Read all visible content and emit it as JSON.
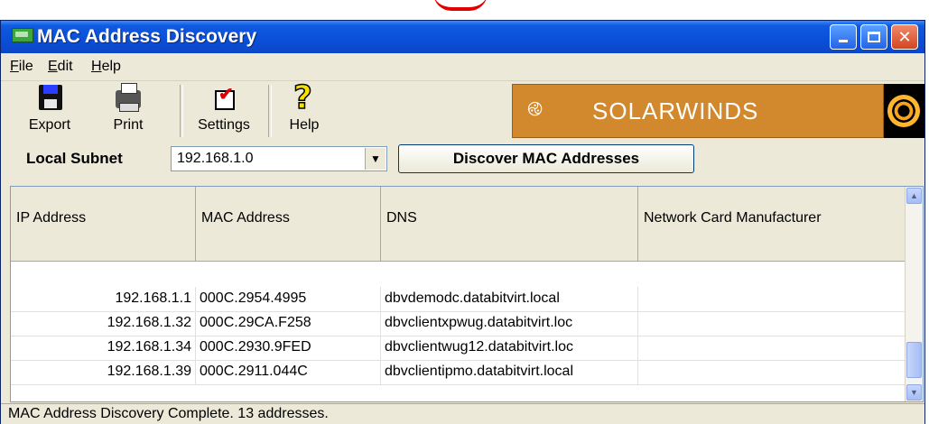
{
  "window": {
    "title": "MAC Address Discovery"
  },
  "menu": [
    {
      "label": "File",
      "underline": "F",
      "rest": "ile"
    },
    {
      "label": "Edit",
      "underline": "E",
      "rest": "dit"
    },
    {
      "label": "Help",
      "underline": "H",
      "rest": "elp"
    }
  ],
  "toolbar": {
    "export_label": "Export",
    "print_label": "Print",
    "settings_label": "Settings",
    "help_label": "Help"
  },
  "brand": {
    "name": "SOLARWINDS",
    "color": "#d2882c"
  },
  "subnet": {
    "label": "Local Subnet",
    "value": "192.168.1.0"
  },
  "discover_button": "Discover MAC Addresses",
  "table": {
    "columns": [
      "IP Address",
      "MAC Address",
      "DNS",
      "Network Card Manufacturer"
    ],
    "rows": [
      [
        "192.168.1.1",
        "000C.2954.4995",
        "dbvdemodc.databitvirt.local",
        ""
      ],
      [
        "192.168.1.32",
        "000C.29CA.F258",
        "dbvclientxpwug.databitvirt.loc",
        ""
      ],
      [
        "192.168.1.34",
        "000C.2930.9FED",
        "dbvclientwug12.databitvirt.loc",
        ""
      ],
      [
        "192.168.1.39",
        "000C.2911.044C",
        "dbvclientipmo.databitvirt.local",
        ""
      ]
    ]
  },
  "status": "MAC Address Discovery Complete. 13 addresses."
}
